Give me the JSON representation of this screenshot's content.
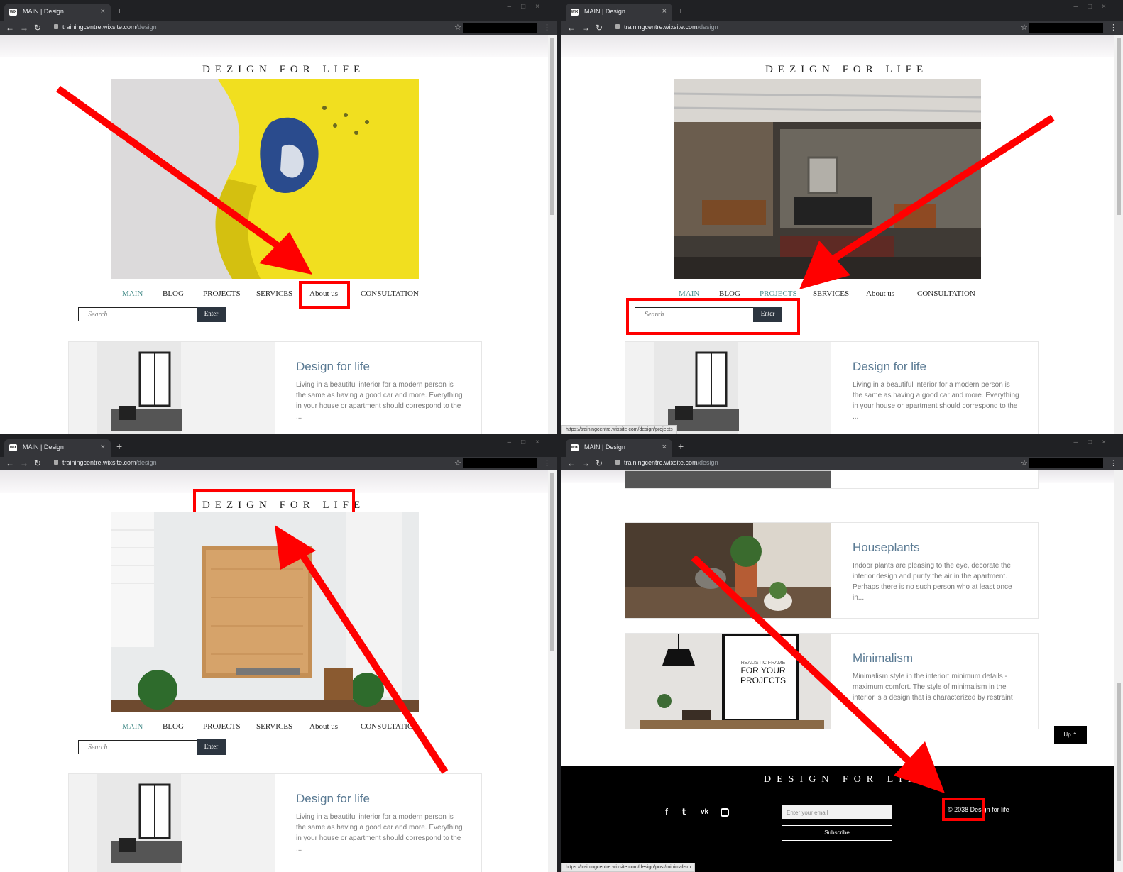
{
  "browser": {
    "tab_title": "MAIN | Design",
    "favicon_text": "WIX",
    "close_glyph": "×",
    "new_tab_glyph": "+",
    "url_domain": "trainingcentre.wixsite.com",
    "url_path": "/design"
  },
  "site": {
    "logo_top": "DEZIGN FOR LIFE",
    "menu": [
      "MAIN",
      "BLOG",
      "PROJECTS",
      "SERVICES",
      "About us",
      "CONSULTATION"
    ],
    "search_placeholder": "Search",
    "enter_label": "Enter"
  },
  "posts": [
    {
      "title": "Design for life",
      "text": "Living in a beautiful interior for a modern person is the same as having a good car and more. Everything in your house or apartment should correspond to the ..."
    },
    {
      "title": "Houseplants",
      "text": "Indoor plants are pleasing to the eye, decorate the interior design and purify the air in the apartment. Perhaps there is no such person who at least once in..."
    },
    {
      "title": "Minimalism",
      "text": "Minimalism style in the interior: minimum details - maximum comfort. The style of minimalism in the interior is a design that is characterized by restraint a..."
    }
  ],
  "poster": {
    "small": "REALISTIC FRAME",
    "big": "FOR YOUR PROJECTS"
  },
  "footer": {
    "logo": "DESIGN FOR LIFE",
    "email_placeholder": "Enter your email",
    "subscribe_label": "Subscribe",
    "copyright": "© 2038 Design for life",
    "up_label": "Up ⌃",
    "social_icons": [
      "facebook-icon",
      "twitter-icon",
      "vk-icon",
      "instagram-icon"
    ]
  },
  "status": {
    "p2": "https://trainingcentre.wixsite.com/design/projects",
    "p4": "https://trainingcentre.wixsite.com/design/post/minimalism"
  },
  "colors": {
    "highlight": "#ff0000",
    "menu_active": "#4a8f8c",
    "post_title": "#5a7a93"
  }
}
